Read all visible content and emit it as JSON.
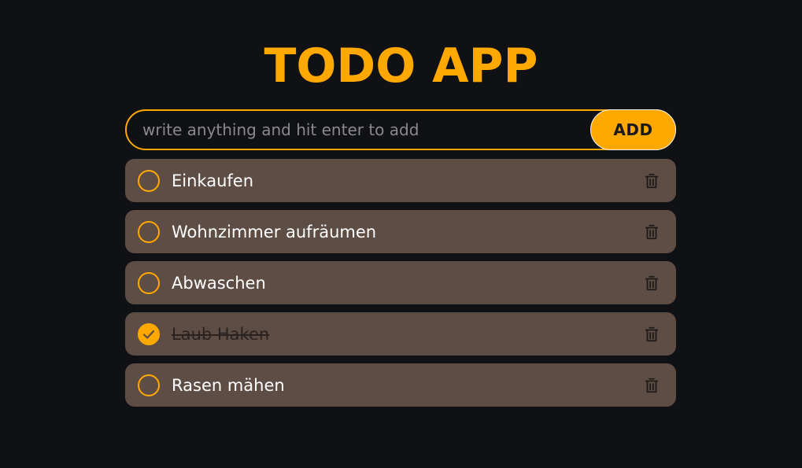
{
  "header": {
    "title": "TODO APP"
  },
  "input": {
    "placeholder": "write anything and hit enter to add",
    "value": ""
  },
  "add_button": {
    "label": "ADD"
  },
  "todos": [
    {
      "label": "Einkaufen",
      "done": false
    },
    {
      "label": "Wohnzimmer aufräumen",
      "done": false
    },
    {
      "label": "Abwaschen",
      "done": false
    },
    {
      "label": "Laub Haken",
      "done": true
    },
    {
      "label": "Rasen mähen",
      "done": false
    }
  ],
  "icons": {
    "check": "check-circle-icon",
    "delete": "trash-icon"
  },
  "colors": {
    "accent": "#ffa800",
    "background": "#0f1114",
    "item": "#5e4d45"
  }
}
